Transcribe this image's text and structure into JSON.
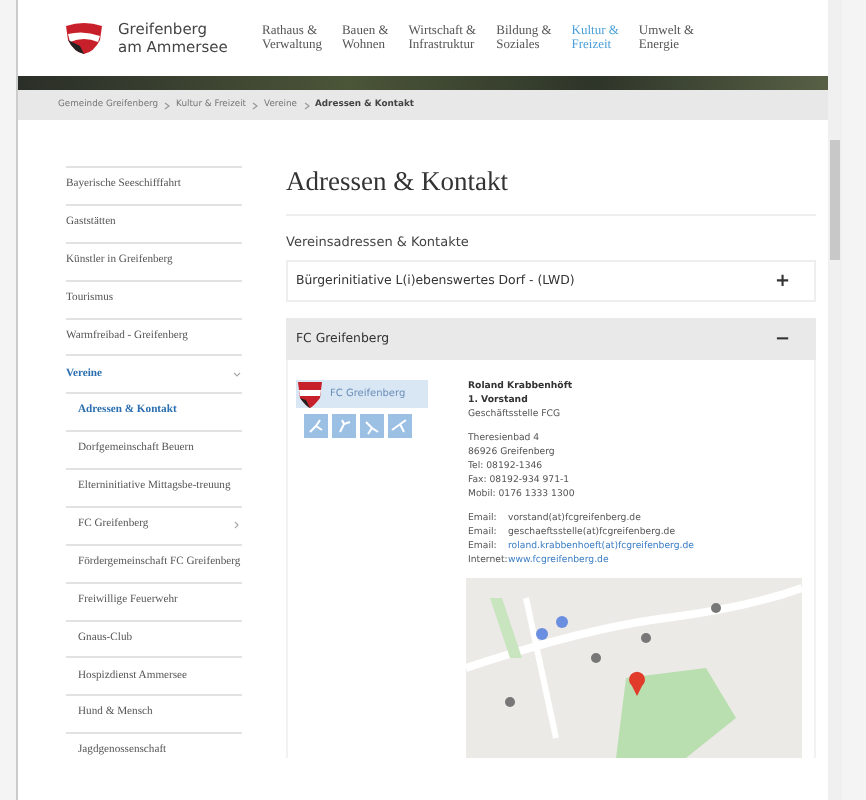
{
  "header": {
    "brand_line1": "Greifenberg",
    "brand_line2": "am Ammersee",
    "nav": [
      {
        "line1": "Rathaus &",
        "line2": "Verwaltung",
        "selected": false
      },
      {
        "line1": "Bauen &",
        "line2": "Wohnen",
        "selected": false
      },
      {
        "line1": "Wirtschaft &",
        "line2": "Infrastruktur",
        "selected": false
      },
      {
        "line1": "Bildung &",
        "line2": "Soziales",
        "selected": false
      },
      {
        "line1": "Kultur &",
        "line2": "Freizeit",
        "selected": true
      },
      {
        "line1": "Umwelt &",
        "line2": "Energie",
        "selected": false
      }
    ]
  },
  "breadcrumb": [
    {
      "label": "Gemeinde Greifenberg",
      "current": false
    },
    {
      "label": "Kultur & Freizeit",
      "current": false
    },
    {
      "label": "Vereine",
      "current": false
    },
    {
      "label": "Adressen & Kontakt",
      "current": true
    }
  ],
  "sidebar": {
    "items": [
      {
        "label": "Bayerische Seeschifffahrt",
        "selected": false
      },
      {
        "label": "Gaststätten",
        "selected": false
      },
      {
        "label": "Künstler in Greifenberg",
        "selected": false
      },
      {
        "label": "Tourismus",
        "selected": false
      },
      {
        "label": "Warmfreibad - Greifenberg",
        "selected": false
      },
      {
        "label": "Vereine",
        "selected": true,
        "expanded": true,
        "children": [
          {
            "label": "Adressen & Kontakt",
            "selected": true,
            "has_children": false
          },
          {
            "label": "Dorfgemeinschaft Beuern",
            "selected": false,
            "has_children": false
          },
          {
            "label": "Elterninitiative Mittagsbe-treuung",
            "selected": false,
            "has_children": false
          },
          {
            "label": "FC Greifenberg",
            "selected": false,
            "has_children": true
          },
          {
            "label": "Fördergemeinschaft FC Greifenberg",
            "selected": false,
            "has_children": false
          },
          {
            "label": "Freiwillige Feuerwehr",
            "selected": false,
            "has_children": false
          },
          {
            "label": "Gnaus-Club",
            "selected": false,
            "has_children": false
          },
          {
            "label": "Hospizdienst Ammersee",
            "selected": false,
            "has_children": false
          },
          {
            "label": "Hund & Mensch",
            "selected": false,
            "has_children": false
          },
          {
            "label": "Jagdgenossenschaft",
            "selected": false,
            "has_children": false
          }
        ]
      }
    ]
  },
  "main": {
    "title": "Adressen & Kontakt",
    "subtitle": "Vereinsadressen & Kontakte",
    "accordion": [
      {
        "label": "Bürgerinitiative L(i)ebenswertes Dorf - (LWD)",
        "expanded": false,
        "toggle": "+"
      },
      {
        "label": "FC Greifenberg",
        "expanded": true,
        "toggle": "−"
      }
    ],
    "contact": {
      "logo_text": "FC Greifenberg",
      "name": "Roland Krabbenhöft",
      "role": "1. Vorstand",
      "office": "Geschäftsstelle FCG",
      "address": [
        "Theresienbad 4",
        "86926 Greifenberg",
        "Tel: 08192-1346",
        "Fax: 08192-934 971-1",
        "Mobil: 0176 1333 1300"
      ],
      "links": [
        {
          "label": "Email:",
          "value": "vorstand(at)fcgreifenberg.de",
          "kind": "plain"
        },
        {
          "label": "Email:",
          "value": "geschaeftsstelle(at)fcgreifenberg.de",
          "kind": "plain"
        },
        {
          "label": "Email:",
          "value": "roland.krabbenhoeft(at)fcgreifenberg.de",
          "kind": "link"
        },
        {
          "label": "Internet:",
          "value": "www.fcgreifenberg.de",
          "kind": "link"
        }
      ]
    }
  }
}
